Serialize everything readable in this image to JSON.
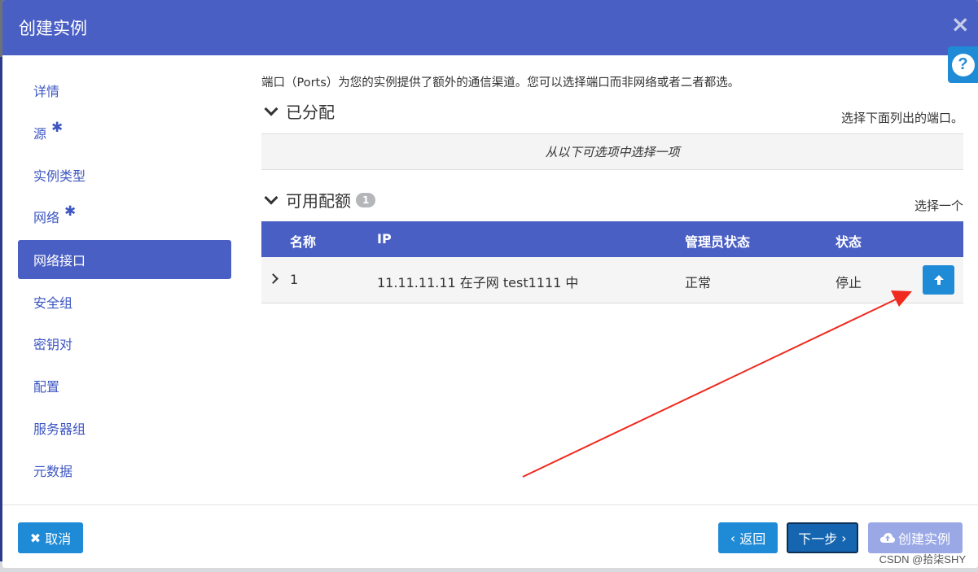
{
  "modal": {
    "title": "创建实例",
    "close_icon": "×"
  },
  "help": {
    "icon": "?"
  },
  "sidebar": {
    "items": [
      {
        "label": "详情",
        "required": false
      },
      {
        "label": "源",
        "required": true
      },
      {
        "label": "实例类型",
        "required": false
      },
      {
        "label": "网络",
        "required": true
      },
      {
        "label": "网络接口",
        "required": false,
        "active": true
      },
      {
        "label": "安全组",
        "required": false
      },
      {
        "label": "密钥对",
        "required": false
      },
      {
        "label": "配置",
        "required": false
      },
      {
        "label": "服务器组",
        "required": false
      },
      {
        "label": "元数据",
        "required": false
      }
    ],
    "required_mark": "✱"
  },
  "content": {
    "intro": "端口（Ports）为您的实例提供了额外的通信渠道。您可以选择端口而非网络或者二者都选。",
    "allocated": {
      "title": "已分配",
      "hint": "选择下面列出的端口。",
      "empty": "从以下可选项中选择一项"
    },
    "available": {
      "title": "可用配额",
      "count": "1",
      "hint": "选择一个",
      "columns": [
        "名称",
        "IP",
        "管理员状态",
        "状态"
      ],
      "rows": [
        {
          "name": "1",
          "ip": "11.11.11.11 在子网 test1111 中",
          "admin_state": "正常",
          "status": "停止"
        }
      ]
    }
  },
  "footer": {
    "cancel": "取消",
    "back": "返回",
    "next": "下一步",
    "create": "创建实例"
  },
  "watermark": "CSDN @拾柒SHY",
  "colors": {
    "header": "#4a5fc4",
    "primary_button": "#1f8ad6",
    "disabled_button": "#9aa9e6",
    "annotation_arrow": "#f02a1e"
  }
}
